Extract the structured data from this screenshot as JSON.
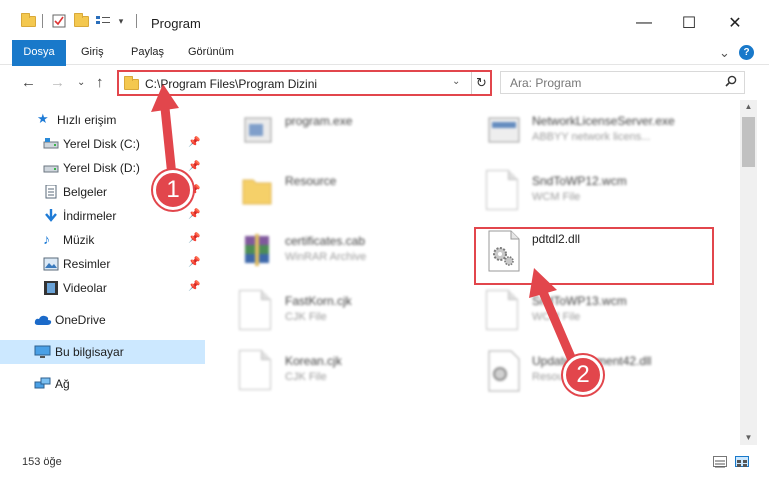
{
  "window": {
    "title": "Program",
    "minimize": "—",
    "maximize": "☐",
    "close": "✕"
  },
  "ribbon": {
    "tabs": [
      "Dosya",
      "Giriş",
      "Paylaş",
      "Görünüm"
    ],
    "expand": "⌄",
    "help": "?"
  },
  "address": {
    "path": "C:\\Program Files\\Program Dizini",
    "dropdown": "⌄",
    "refresh": "↻"
  },
  "search": {
    "placeholder": "Ara: Program",
    "icon": "search-icon"
  },
  "nav": {
    "back": "←",
    "forward": "→",
    "recent": "⌄",
    "up": "↑"
  },
  "sidebar": {
    "quick_access": "Hızlı erişim",
    "items": [
      {
        "label": "Yerel Disk (C:)",
        "icon": "drive-icon"
      },
      {
        "label": "Yerel Disk (D:)",
        "icon": "drive-icon"
      },
      {
        "label": "Belgeler",
        "icon": "documents-icon"
      },
      {
        "label": "İndirmeler",
        "icon": "download-icon"
      },
      {
        "label": "Müzik",
        "icon": "music-icon"
      },
      {
        "label": "Resimler",
        "icon": "pictures-icon"
      },
      {
        "label": "Videolar",
        "icon": "videos-icon"
      }
    ],
    "onedrive": "OneDrive",
    "this_pc": "Bu bilgisayar",
    "network": "Ağ"
  },
  "files": {
    "left": [
      {
        "name": "program.exe",
        "type": ""
      },
      {
        "name": "Resource",
        "type": ""
      },
      {
        "name": "certificates.cab",
        "type": "WinRAR Archive"
      },
      {
        "name": "FastKorn.cjk",
        "type": "CJK File"
      },
      {
        "name": "Korean.cjk",
        "type": "CJK File"
      }
    ],
    "right": [
      {
        "name": "NetworkLicenseServer.exe",
        "type": "ABBYY network licens..."
      },
      {
        "name": "SndToWP12.wcm",
        "type": "WCM File"
      },
      {
        "name": "pdtdl2.dll",
        "type": ""
      },
      {
        "name": "SndToWP13.wcm",
        "type": "WCM File"
      },
      {
        "name": "UpdateComment42.dll",
        "type": "Resource"
      }
    ]
  },
  "status": {
    "count": "153 öğe"
  },
  "callouts": {
    "one": "1",
    "two": "2"
  },
  "colors": {
    "accent": "#1979ca",
    "highlight": "#e2464c",
    "selected": "#cce8ff"
  }
}
